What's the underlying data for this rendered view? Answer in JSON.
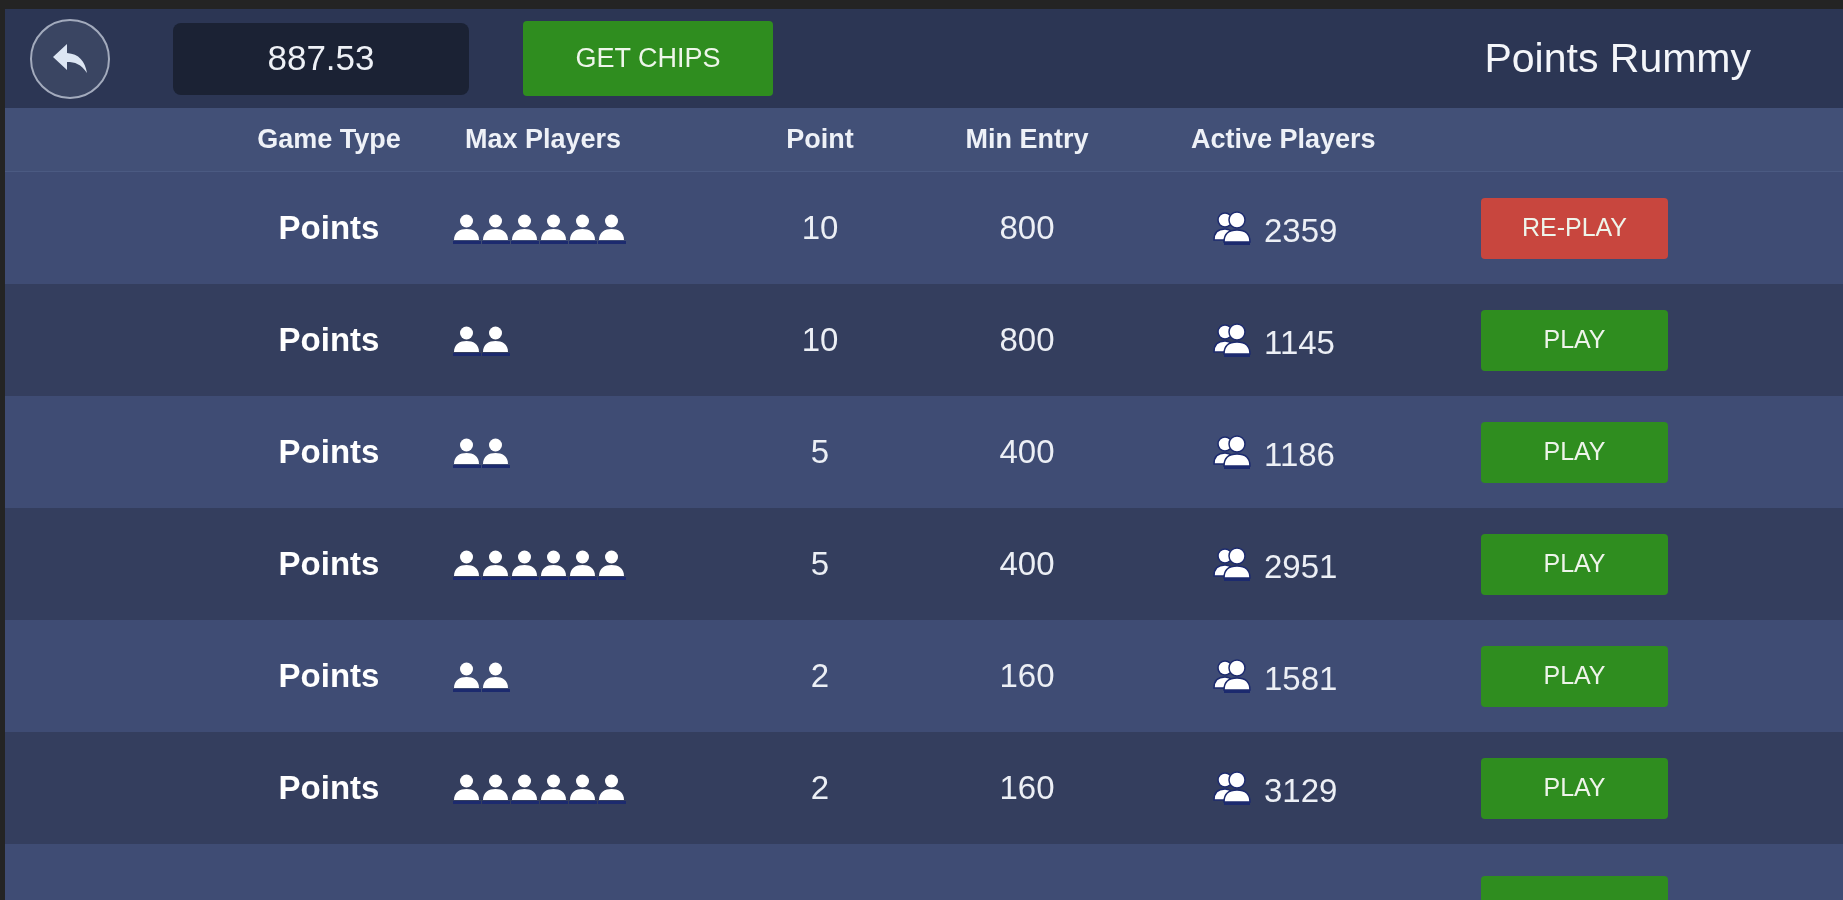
{
  "top_bar": {
    "balance": "887.53",
    "get_chips_button": "GET CHIPS",
    "title": "Points Rummy"
  },
  "table": {
    "columns": [
      "Game Type",
      "Max Players",
      "Point",
      "Min Entry",
      "Active Players"
    ],
    "rows": [
      {
        "game_type": "Points",
        "max_players": {
          "kind": "six"
        },
        "point": "10",
        "min_entry": "800",
        "active_players": "2359",
        "action": {
          "label": "RE-PLAY",
          "kind": "replay"
        }
      },
      {
        "game_type": "Points",
        "max_players": {
          "kind": "two"
        },
        "point": "10",
        "min_entry": "800",
        "active_players": "1145",
        "action": {
          "label": "PLAY",
          "kind": "play"
        }
      },
      {
        "game_type": "Points",
        "max_players": {
          "kind": "two"
        },
        "point": "5",
        "min_entry": "400",
        "active_players": "1186",
        "action": {
          "label": "PLAY",
          "kind": "play"
        }
      },
      {
        "game_type": "Points",
        "max_players": {
          "kind": "six"
        },
        "point": "5",
        "min_entry": "400",
        "active_players": "2951",
        "action": {
          "label": "PLAY",
          "kind": "play"
        }
      },
      {
        "game_type": "Points",
        "max_players": {
          "kind": "two"
        },
        "point": "2",
        "min_entry": "160",
        "active_players": "1581",
        "action": {
          "label": "PLAY",
          "kind": "play"
        }
      },
      {
        "game_type": "Points",
        "max_players": {
          "kind": "six"
        },
        "point": "2",
        "min_entry": "160",
        "active_players": "3129",
        "action": {
          "label": "PLAY",
          "kind": "play"
        }
      }
    ],
    "cut_off_row": {
      "action": {
        "kind": "play"
      }
    }
  }
}
